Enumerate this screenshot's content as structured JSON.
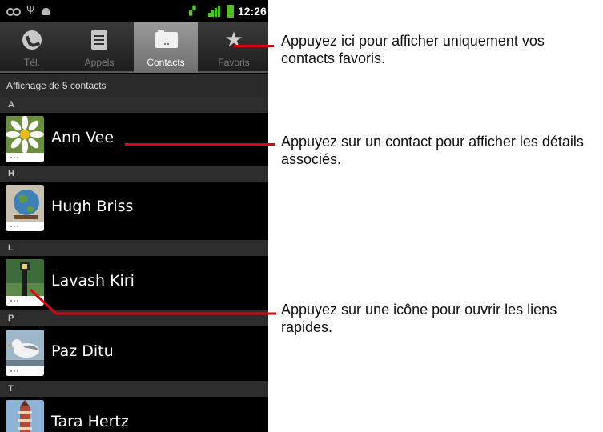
{
  "status_bar": {
    "time": "12:26",
    "icons": [
      "voicemail-icon",
      "usb-icon",
      "debug-icon",
      "sim-icon",
      "signal-icon",
      "battery-icon"
    ],
    "signal_color": "#4cc21e"
  },
  "tabs": [
    {
      "label": "Tél.",
      "icon": "phone-icon",
      "active": false
    },
    {
      "label": "Appels",
      "icon": "call-log-icon",
      "active": false
    },
    {
      "label": "Contacts",
      "icon": "contacts-icon",
      "active": true
    },
    {
      "label": "Favoris",
      "icon": "star-icon",
      "active": false
    }
  ],
  "list": {
    "header": "Affichage de 5 contacts",
    "sections": [
      {
        "letter": "A",
        "contacts": [
          {
            "name": "Ann Vee",
            "photo": "daisy-photo"
          }
        ]
      },
      {
        "letter": "H",
        "contacts": [
          {
            "name": "Hugh Briss",
            "photo": "globe-photo"
          }
        ]
      },
      {
        "letter": "L",
        "contacts": [
          {
            "name": "Lavash Kiri",
            "photo": "lamp-post-photo"
          }
        ]
      },
      {
        "letter": "P",
        "contacts": [
          {
            "name": "Paz Ditu",
            "photo": "seagull-photo"
          }
        ]
      },
      {
        "letter": "T",
        "contacts": [
          {
            "name": "Tara Hertz",
            "photo": "tower-photo"
          }
        ]
      }
    ]
  },
  "annotations": {
    "favorites": "Appuyez ici pour afficher uniquement vos contacts favoris.",
    "contact": "Appuyez sur un contact pour afficher les détails associés.",
    "icon": "Appuyez sur une icône pour ouvrir les liens rapides."
  },
  "colors": {
    "callout": "#e3000e",
    "active_tab": "#8a8a8a",
    "list_background": "#000000"
  }
}
